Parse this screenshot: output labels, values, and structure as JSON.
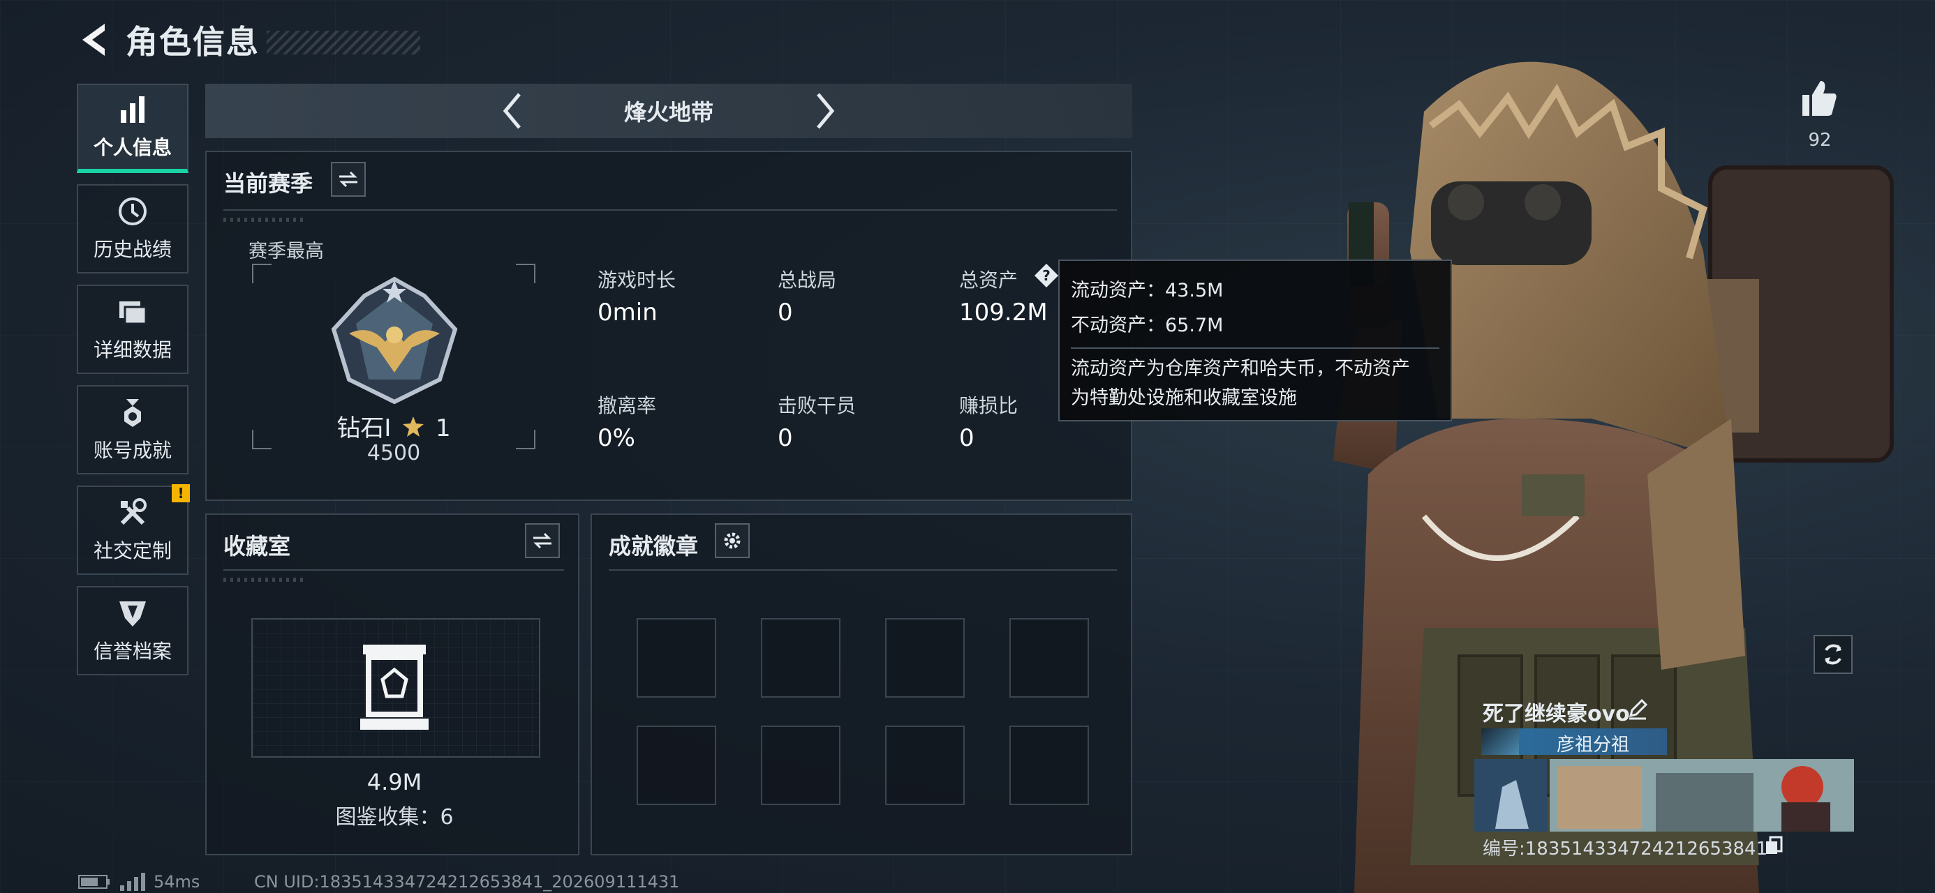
{
  "header": {
    "title": "角色信息"
  },
  "sidebar": {
    "items": [
      {
        "label": "个人信息",
        "active": true,
        "icon": "bar-chart-icon"
      },
      {
        "label": "历史战绩",
        "icon": "clock-icon"
      },
      {
        "label": "详细数据",
        "icon": "folder-icon"
      },
      {
        "label": "账号成就",
        "icon": "medal-icon"
      },
      {
        "label": "社交定制",
        "icon": "tools-icon",
        "badge": "!"
      },
      {
        "label": "信誉档案",
        "icon": "shield-icon"
      }
    ]
  },
  "mode": {
    "label": "烽火地带"
  },
  "season": {
    "title": "当前赛季",
    "best_label": "赛季最高",
    "rank_name": "钻石I",
    "rank_stars": "1",
    "rank_score": "4500",
    "stats": [
      {
        "label": "游戏时长",
        "value": "0min"
      },
      {
        "label": "总战局",
        "value": "0"
      },
      {
        "label": "总资产",
        "value": "109.2M"
      },
      {
        "label": "撤离率",
        "value": "0%"
      },
      {
        "label": "击败干员",
        "value": "0"
      },
      {
        "label": "赚损比",
        "value": "0"
      }
    ]
  },
  "tooltip": {
    "liquid": "流动资产：43.5M",
    "fixed": "不动资产：65.7M",
    "note_line1": "流动资产为仓库资产和哈夫币，不动资产",
    "note_line2": "为特勤处设施和收藏室设施"
  },
  "collection": {
    "title": "收藏室",
    "value": "4.9M",
    "count": "图鉴收集：6"
  },
  "achievements": {
    "title": "成就徽章",
    "slots": 8
  },
  "profile": {
    "likes": "92",
    "name": "死了继续豪ovo",
    "clan": "彦祖分祖",
    "id": "编号:1835143347242126538​41"
  },
  "footer": {
    "ping": "54ms",
    "uid": "CN UID:183514334724212653841_202609111431"
  },
  "colors": {
    "accent": "#19d3a6",
    "alert": "#f5b400"
  }
}
